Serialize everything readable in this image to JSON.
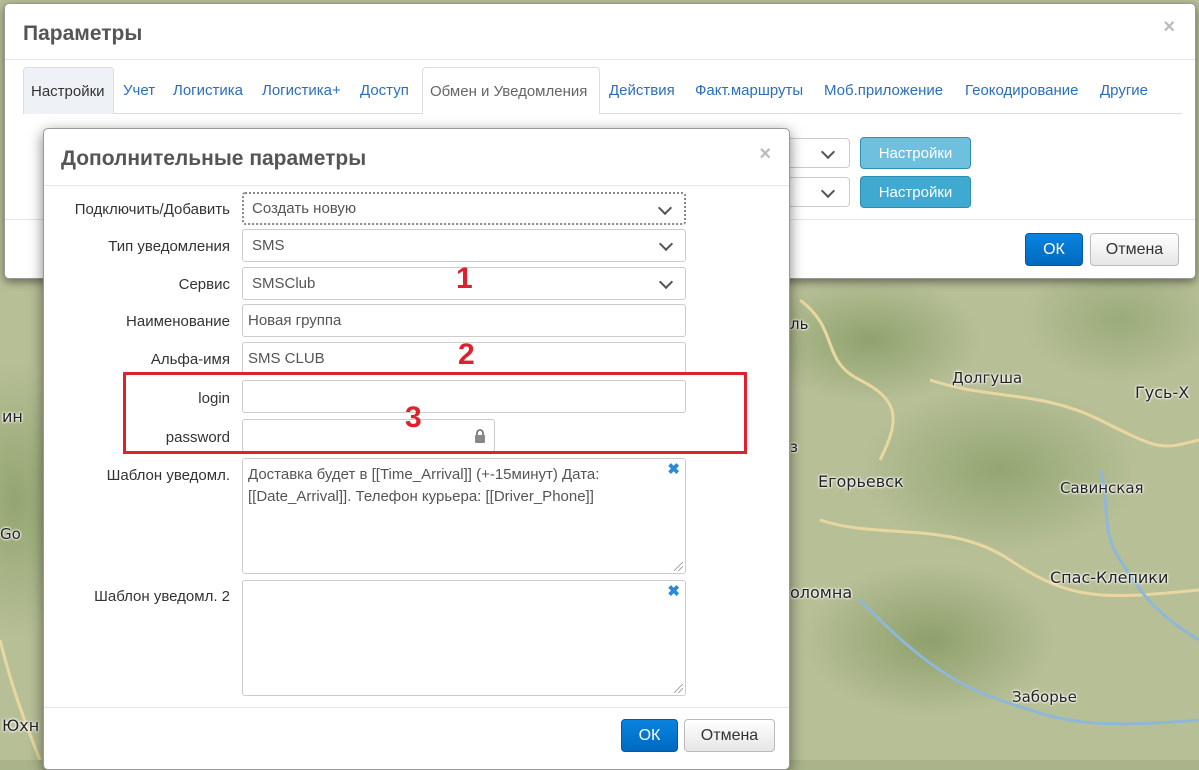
{
  "map": {
    "labels": [
      "Долгуша",
      "Гусь-Х",
      "Егорьевск",
      "Савинская",
      "Спас-Клепики",
      "оломна",
      "Заборье",
      "Юхн",
      "ин",
      "Go",
      "ль",
      "з"
    ]
  },
  "outer_dialog": {
    "title": "Параметры",
    "close_glyph": "×",
    "tabs": [
      "Настройки",
      "Учет",
      "Логистика",
      "Логистика+",
      "Доступ",
      "Обмен и Уведомления",
      "Действия",
      "Факт.маршруты",
      "Моб.приложение",
      "Геокодирование",
      "Другие"
    ],
    "active_tab": "Настройки",
    "settings_buttons": [
      "Настройки",
      "Настройки"
    ],
    "ok_label": "ОК",
    "cancel_label": "Отмена"
  },
  "inner_dialog": {
    "title": "Дополнительные параметры",
    "close_glyph": "×",
    "fields": {
      "connect": {
        "label": "Подключить/Добавить",
        "value": "Создать новую"
      },
      "notify_type": {
        "label": "Тип уведомления",
        "value": "SMS"
      },
      "service": {
        "label": "Сервис",
        "value": "SMSClub"
      },
      "name": {
        "label": "Наименование",
        "value": "Новая группа"
      },
      "alpha": {
        "label": "Альфа-имя",
        "value": "SMS CLUB"
      },
      "login": {
        "label": "login",
        "value": ""
      },
      "password": {
        "label": "password",
        "value": ""
      },
      "template1": {
        "label": "Шаблон уведомл.",
        "value": "Доставка будет в [[Time_Arrival]] (+-15минут) Дата: [[Date_Arrival]]. Телефон курьера: [[Driver_Phone]]"
      },
      "template2": {
        "label": "Шаблон уведомл. 2",
        "value": ""
      }
    },
    "clear_glyph": "✖",
    "ok_label": "ОК",
    "cancel_label": "Отмена"
  },
  "annotations": {
    "n1": "1",
    "n2": "2",
    "n3": "3"
  },
  "colors": {
    "link": "#2a6ebd",
    "primary": "#0a7bd8",
    "annotation": "#e0202c",
    "settings_button": "#3fa9d0"
  }
}
